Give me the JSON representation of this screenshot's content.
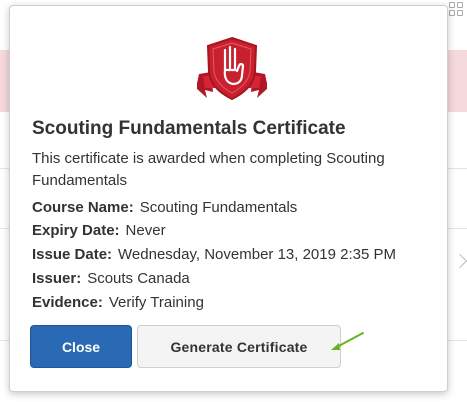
{
  "modal": {
    "badge_icon": "scout-salute-shield-icon",
    "title": "Scouting Fundamentals Certificate",
    "description": "This certificate is awarded when completing Scouting Fundamentals",
    "fields": [
      {
        "label": "Course Name:",
        "value": "Scouting Fundamentals"
      },
      {
        "label": "Expiry Date:",
        "value": "Never"
      },
      {
        "label": "Issue Date:",
        "value": "Wednesday, November 13, 2019 2:35 PM"
      },
      {
        "label": "Issuer:",
        "value": "Scouts Canada"
      },
      {
        "label": "Evidence:",
        "value": "Verify Training"
      }
    ],
    "buttons": {
      "close_label": "Close",
      "generate_label": "Generate Certificate"
    }
  },
  "colors": {
    "primary_button": "#2a6ab5",
    "badge_red": "#c8202f",
    "arrow_green": "#6ab023",
    "background_banner": "#f6d9dc"
  }
}
